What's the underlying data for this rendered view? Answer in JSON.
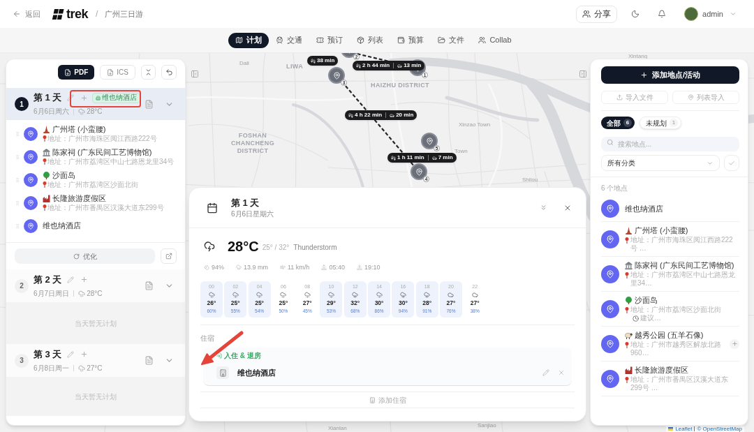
{
  "header": {
    "back": "返回",
    "logo": "trek",
    "separator": "/",
    "trip_title": "广州三日游",
    "share": "分享",
    "user": "admin"
  },
  "tabs": [
    {
      "label": "计划",
      "selected": true
    },
    {
      "label": "交通",
      "selected": false
    },
    {
      "label": "预订",
      "selected": false
    },
    {
      "label": "列表",
      "selected": false
    },
    {
      "label": "预算",
      "selected": false
    },
    {
      "label": "文件",
      "selected": false
    },
    {
      "label": "Collab",
      "selected": false
    }
  ],
  "map": {
    "labels": [
      {
        "text": "Xintang",
        "kind": "town"
      },
      {
        "text": "Dali",
        "kind": "town"
      },
      {
        "text": "LIWA",
        "kind": "district"
      },
      {
        "text": "HAIZHU DISTRICT",
        "kind": "district"
      },
      {
        "text": "FOSHAN CHANCHENG DISTRICT",
        "kind": "district"
      },
      {
        "text": "Xinzao Town",
        "kind": "town"
      },
      {
        "text": "Town",
        "kind": "town"
      },
      {
        "text": "Shilou",
        "kind": "town"
      },
      {
        "text": "Sanjiao",
        "kind": "town"
      },
      {
        "text": "Xianlan",
        "kind": "town"
      }
    ],
    "markers": [
      {
        "number": "2"
      },
      {
        "number": "3"
      },
      {
        "number": "1"
      },
      {
        "number": "5"
      },
      {
        "number": "4"
      }
    ],
    "routes": [
      {
        "walk": "38 min"
      },
      {
        "walk": "2 h 44 min",
        "drive": "13 min"
      },
      {
        "walk": "4 h 22 min",
        "drive": "20 min"
      },
      {
        "walk": "1 h 11 min",
        "drive": "7 min"
      }
    ],
    "attribution": [
      "Leaflet",
      "© OpenStreetMap"
    ]
  },
  "day_panel": {
    "exports": [
      {
        "label": "PDF",
        "primary": true
      },
      {
        "label": "ICS",
        "primary": false
      }
    ],
    "days": [
      {
        "number": "1",
        "title": "第 1 天",
        "date": "6月6日周六",
        "weather": "28°C",
        "selected": true,
        "hotel": "维也纳酒店",
        "places": [
          {
            "kind": "tower",
            "name": "广州塔 (小蛮腰)",
            "address": "地址：广州市海珠区阅江西路222号"
          },
          {
            "kind": "temple",
            "name": "陈家祠 (广东民间工艺博物馆)",
            "address": "地址：广州市荔湾区中山七路恩龙里34号"
          },
          {
            "kind": "tree",
            "name": "沙面岛",
            "address": "地址：广州市荔湾区沙面北街"
          },
          {
            "kind": "resort",
            "name": "长隆旅游度假区",
            "address": "地址：广州市番禺区汉溪大道东299号"
          },
          {
            "kind": "plain",
            "name": "维也纳酒店"
          }
        ],
        "optimize": "优化"
      },
      {
        "number": "2",
        "title": "第 2 天",
        "date": "6月7日周日",
        "weather": "28°C",
        "selected": false,
        "empty": "当天暂无计划"
      },
      {
        "number": "3",
        "title": "第 3 天",
        "date": "6月8日周一",
        "weather": "27°C",
        "selected": false,
        "empty": "当天暂无计划"
      }
    ]
  },
  "day_detail": {
    "title": "第 1 天",
    "date": "6月6日星期六",
    "weather": {
      "temperature": "28°C",
      "range": "25° / 32°",
      "condition": "Thunderstorm",
      "stats": [
        {
          "kind": "humidity",
          "value": "94%"
        },
        {
          "kind": "precipitation",
          "value": "13.9 mm"
        },
        {
          "kind": "wind",
          "value": "11 km/h"
        },
        {
          "kind": "sunrise",
          "value": "05:40"
        },
        {
          "kind": "sunset",
          "value": "19:10"
        }
      ],
      "hourly": [
        {
          "hour": "00",
          "kind": "drizzle",
          "temp": "26°",
          "chance": "60%",
          "highlighted": true
        },
        {
          "hour": "02",
          "kind": "drizzle",
          "temp": "25°",
          "chance": "55%",
          "highlighted": true
        },
        {
          "hour": "04",
          "kind": "drizzle",
          "temp": "25°",
          "chance": "54%",
          "highlighted": true
        },
        {
          "hour": "06",
          "kind": "drizzle",
          "temp": "25°",
          "chance": "50%",
          "highlighted": false
        },
        {
          "hour": "08",
          "kind": "drizzle",
          "temp": "27°",
          "chance": "45%",
          "highlighted": false
        },
        {
          "hour": "10",
          "kind": "drizzle",
          "temp": "29°",
          "chance": "53%",
          "highlighted": true
        },
        {
          "hour": "12",
          "kind": "rain",
          "temp": "32°",
          "chance": "68%",
          "highlighted": true
        },
        {
          "hour": "14",
          "kind": "drizzle",
          "temp": "30°",
          "chance": "86%",
          "highlighted": true
        },
        {
          "hour": "16",
          "kind": "rain",
          "temp": "30°",
          "chance": "94%",
          "highlighted": true
        },
        {
          "hour": "18",
          "kind": "rain",
          "temp": "28°",
          "chance": "91%",
          "highlighted": true
        },
        {
          "hour": "20",
          "kind": "cloud",
          "temp": "27°",
          "chance": "76%",
          "highlighted": true
        },
        {
          "hour": "22",
          "kind": "cloud",
          "temp": "27°",
          "chance": "38%",
          "highlighted": false
        }
      ]
    },
    "accommodation": {
      "heading": "住宿",
      "tag": "入住 & 退房",
      "name": "维也纳酒店"
    },
    "add_accommodation": "添加住宿"
  },
  "places_panel": {
    "add_button": "添加地点/活动",
    "imports": [
      {
        "kind": "upload",
        "label": "导入文件"
      },
      {
        "kind": "pin",
        "label": "列表导入"
      }
    ],
    "filters": [
      {
        "label": "全部",
        "count": "6",
        "selected": true
      },
      {
        "label": "未规划",
        "count": "1",
        "selected": false
      }
    ],
    "search": {
      "placeholder": "搜索地点..."
    },
    "category": {
      "value": "所有分类"
    },
    "count_label": "6 个地点",
    "places": [
      {
        "kind": "plain",
        "name": "维也纳酒店",
        "addable": false
      },
      {
        "kind": "tower",
        "name": "广州塔 (小蛮腰)",
        "address": "地址：广州市海珠区阅江西路222号 …",
        "addable": false
      },
      {
        "kind": "temple",
        "name": "陈家祠 (广东民间工艺博物馆)",
        "address": "地址：广州市荔湾区中山七路恩龙里34…",
        "addable": false
      },
      {
        "kind": "tree",
        "name": "沙面岛",
        "address": "地址：广州市荔湾区沙面北街",
        "note": "建议…",
        "addable": false
      },
      {
        "kind": "sheep",
        "name": "越秀公园 (五羊石像)",
        "address": "地址：广州市越秀区解放北路960…",
        "addable": true
      },
      {
        "kind": "resort",
        "name": "长隆旅游度假区",
        "address": "地址：广州市番禺区汉溪大道东299号 …",
        "addable": false
      }
    ]
  }
}
